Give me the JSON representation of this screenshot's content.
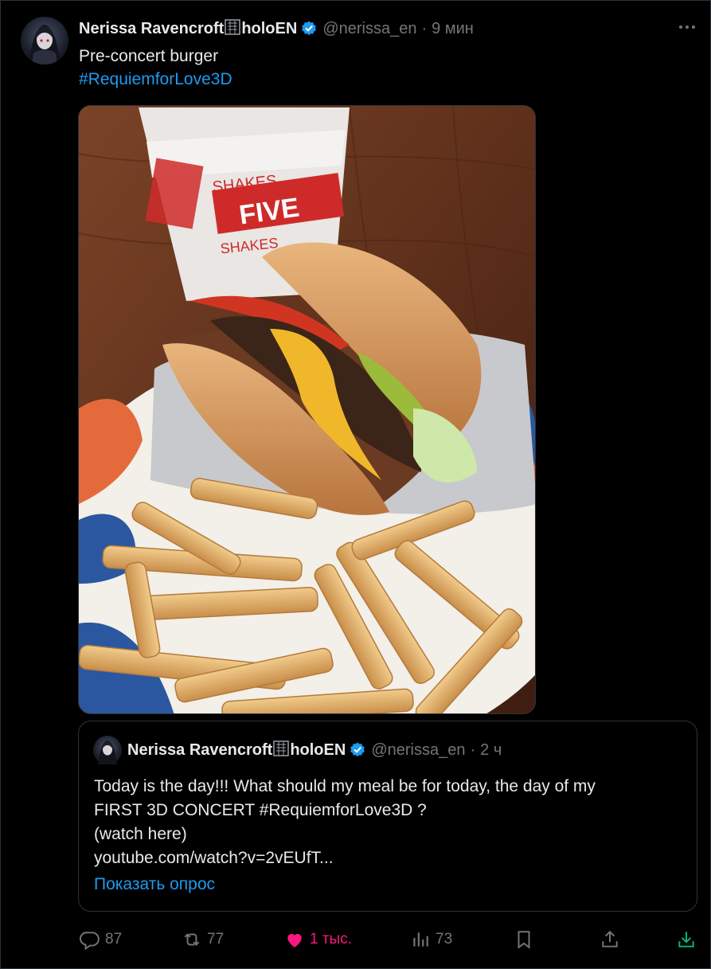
{
  "tweet": {
    "author_name": "Nerissa Ravencroft",
    "author_name_suffix": "holoEN",
    "handle": "@nerissa_en",
    "time": "9 мин",
    "text_line1": "Pre-concert burger",
    "hashtag": "#RequiemforLove3D",
    "more_icon": "more-dots-icon",
    "media_description": "Five Guys cup with burger and fries"
  },
  "quote": {
    "author_name": "Nerissa Ravencroft",
    "author_name_suffix": "holoEN",
    "handle": "@nerissa_en",
    "time": "2 ч",
    "line1": "Today is the day!!! What should my meal be for today, the day of my",
    "line2": "FIRST 3D CONCERT #RequiemforLove3D ?",
    "line3": "(watch here)",
    "line4": "youtube.com/watch?v=2vEUfT...",
    "poll_link": "Показать опрос"
  },
  "actions": {
    "replies": "87",
    "retweets": "77",
    "likes": "1 тыс.",
    "views": "73"
  },
  "colors": {
    "accent": "#1d9bf0",
    "like": "#f91880",
    "muted": "#71767b"
  }
}
